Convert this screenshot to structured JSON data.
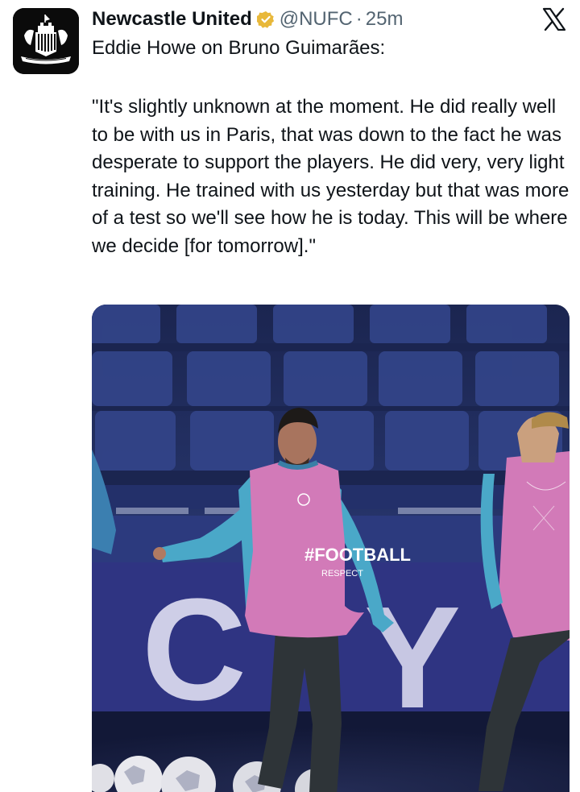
{
  "account": {
    "name": "Newcastle United",
    "handle": "@NUFC",
    "separator": "·",
    "time": "25m",
    "verified": true,
    "avatar_icon": "newcastle-united-crest"
  },
  "tweet": {
    "headline": "Eddie Howe on Bruno Guimarães:",
    "quote": "\"It's slightly unknown at the moment. He did really well to be with us in Paris, that was down to the fact he was desperate to support the players. He did very, very light training. He trained with us yesterday but that was more of a test so we'll see how he is today. This will be where we decide [for tomorrow].\""
  },
  "media": {
    "description_icon": "training-photo",
    "bib_text": "#FOOTBALL",
    "bib_subtext": "RESPECT",
    "board_text": "C Y"
  },
  "colors": {
    "text": "#0f1419",
    "secondary": "#536471",
    "verified_gold": "#e8b83a",
    "bib_pink": "#d27ab8",
    "seats_blue": "#2f3f76"
  }
}
